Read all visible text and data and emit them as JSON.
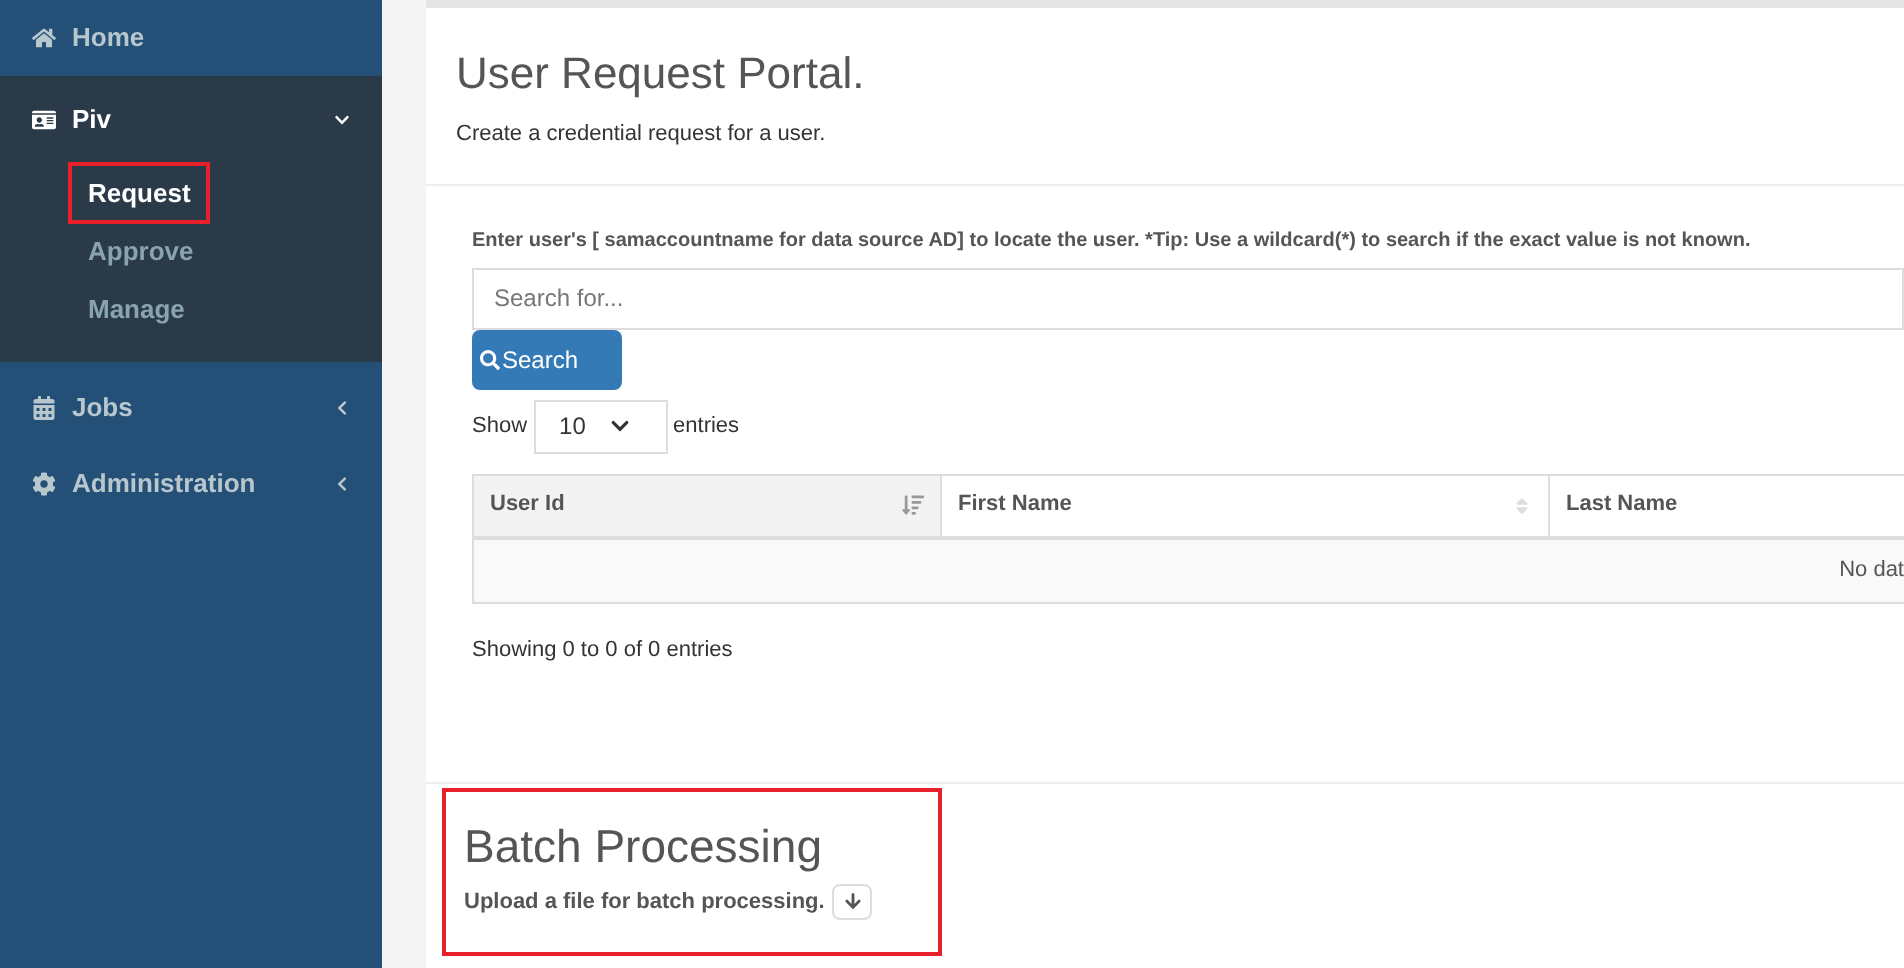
{
  "sidebar": {
    "items": [
      {
        "label": "Home",
        "expanded": false,
        "has_children": false
      },
      {
        "label": "Piv",
        "expanded": true,
        "has_children": true,
        "children": [
          {
            "label": "Request",
            "selected": true,
            "highlighted": true
          },
          {
            "label": "Approve",
            "selected": false,
            "highlighted": false
          },
          {
            "label": "Manage",
            "selected": false,
            "highlighted": false
          }
        ]
      },
      {
        "label": "Jobs",
        "expanded": false,
        "has_children": true
      },
      {
        "label": "Administration",
        "expanded": false,
        "has_children": true
      }
    ]
  },
  "header": {
    "title": "User Request Portal.",
    "subtitle": "Create a credential request for a user."
  },
  "search": {
    "instruction": "Enter user's [ samaccountname for data source AD] to locate the user. *Tip: Use a wildcard(*) to search if the exact value is not known.",
    "placeholder": "Search for...",
    "button": "Search"
  },
  "length": {
    "before": "Show",
    "value": "10",
    "after": "entries"
  },
  "table": {
    "columns": [
      {
        "label": "User Id",
        "sorted": true
      },
      {
        "label": "First Name",
        "sorted": false
      },
      {
        "label": "Last Name",
        "sorted": false
      }
    ],
    "empty": "No dat"
  },
  "info": "Showing 0 to 0 of 0 entries",
  "batch": {
    "title": "Batch Processing",
    "text": "Upload a file for batch processing.",
    "highlighted": true
  }
}
